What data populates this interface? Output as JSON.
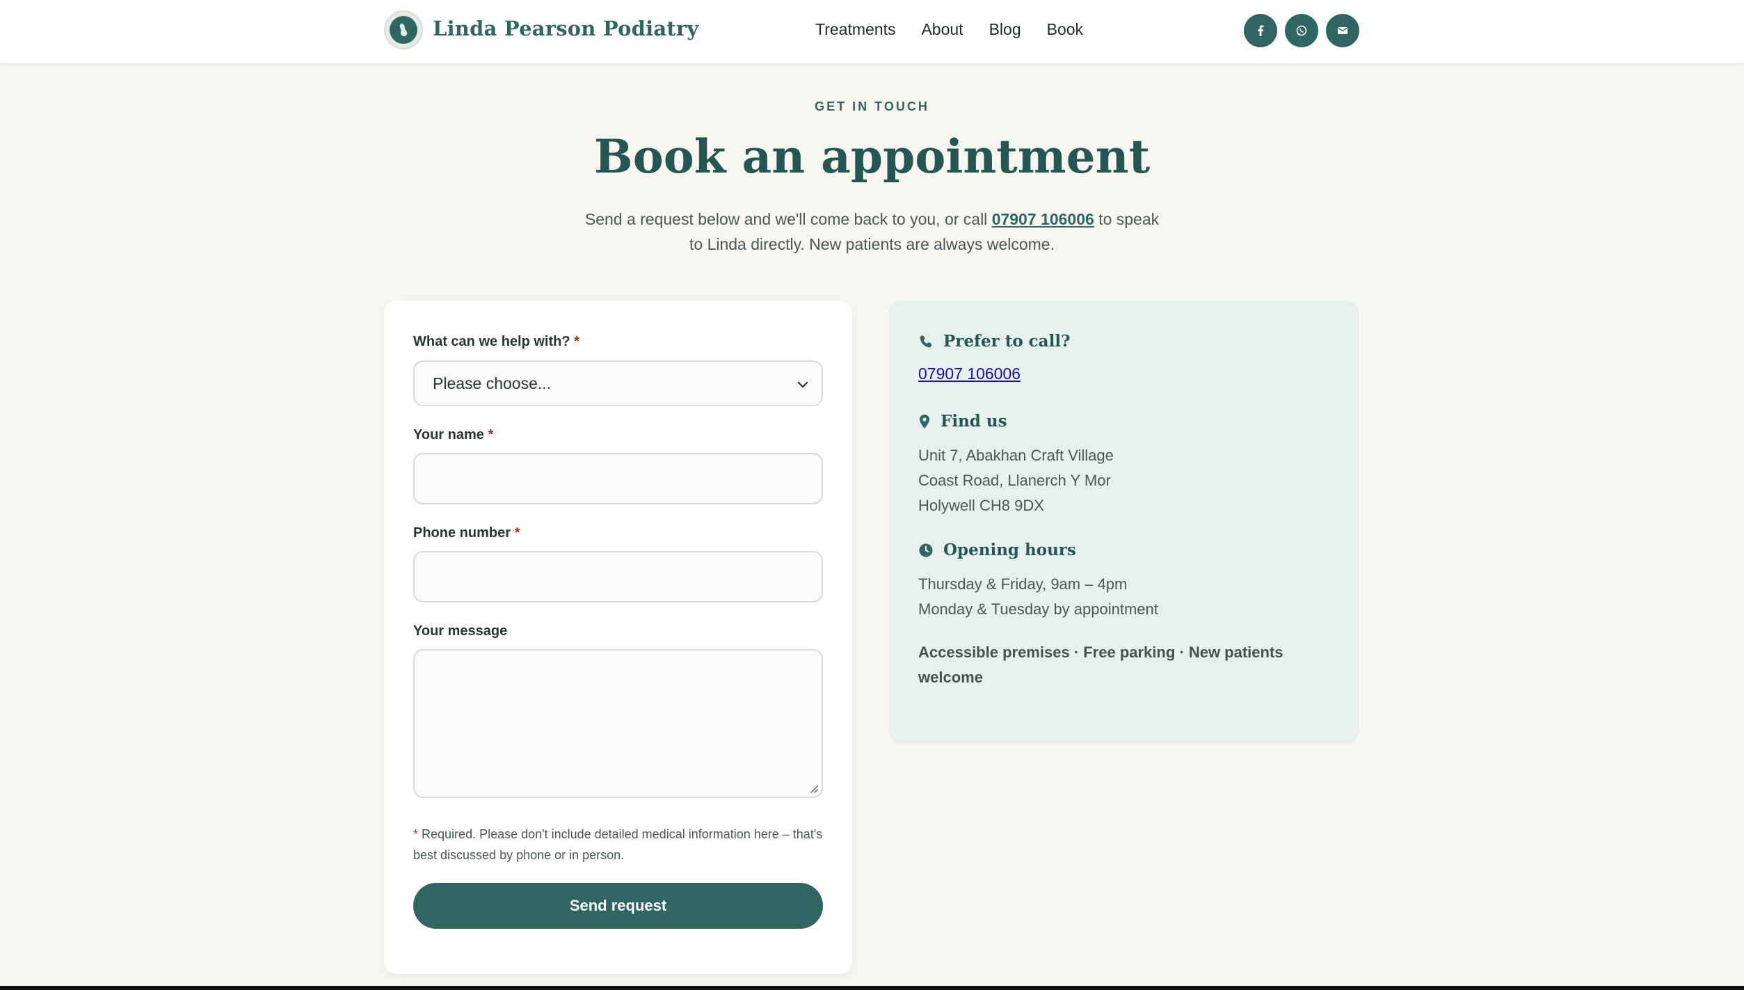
{
  "header": {
    "brand": "Linda Pearson Podiatry",
    "nav": [
      "Treatments",
      "About",
      "Blog",
      "Book"
    ],
    "social_icons": [
      "facebook-icon",
      "whatsapp-icon",
      "email-icon"
    ],
    "accent_color": "#2f6662"
  },
  "hero": {
    "eyebrow": "GET IN TOUCH",
    "title": "Book an appointment",
    "intro_before": "Send a request below and we'll come back to you, or call ",
    "intro_phone": "07907 106006",
    "intro_after": " to speak to Linda directly. New patients are always welcome."
  },
  "form": {
    "help_label": "What can we help with?",
    "help_value": "Please choose...",
    "name_label": "Your name",
    "name_value": "",
    "phone_label": "Phone number",
    "phone_value": "",
    "message_label": "Your message",
    "message_value": "",
    "required_mark": "*",
    "note": "Required. Please don't include detailed medical information here – that's best discussed by phone or in person.",
    "submit_label": "Send request"
  },
  "info": {
    "call_heading": "Prefer to call?",
    "call_number": "07907 106006",
    "find_heading": "Find us",
    "address": [
      "Unit 7, Abakhan Craft Village",
      "Coast Road, Llanerch Y Mor",
      "Holywell CH8 9DX"
    ],
    "hours_heading": "Opening hours",
    "hours": [
      "Thursday & Friday, 9am – 4pm",
      "Monday & Tuesday by appointment"
    ],
    "perks": "Accessible premises · Free parking · New patients welcome"
  }
}
